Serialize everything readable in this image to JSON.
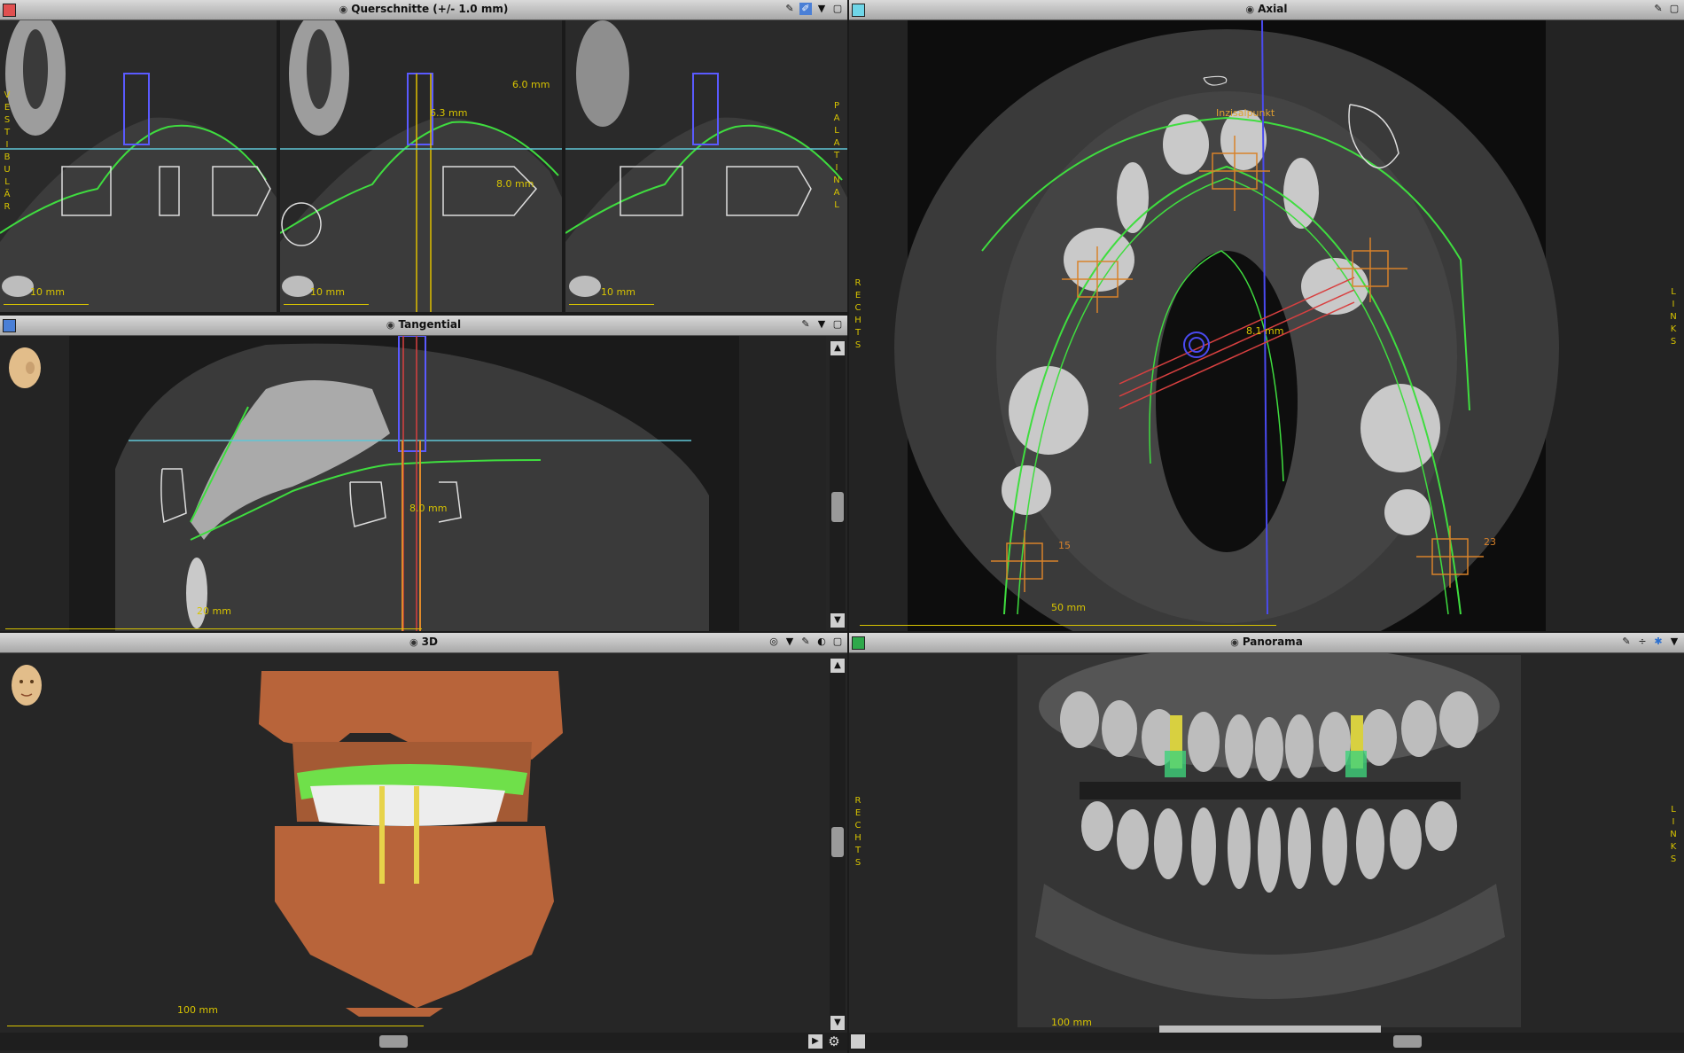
{
  "panels": {
    "cross": {
      "title": "Querschnitte (+/- 1.0 mm)",
      "color": "#e05050",
      "side_left": [
        "V",
        "E",
        "S",
        "T",
        "I",
        "B",
        "U",
        "L",
        "Ä",
        "R"
      ],
      "side_right": [
        "P",
        "A",
        "L",
        "A",
        "T",
        "I",
        "N",
        "A",
        "L"
      ],
      "scales": [
        "10 mm",
        "10 mm",
        "10 mm"
      ],
      "measures": [
        "6.3 mm",
        "8.0 mm",
        "6.0 mm"
      ]
    },
    "axial": {
      "title": "Axial",
      "color": "#6fd6e8",
      "side_left": [
        "R",
        "E",
        "C",
        "H",
        "T",
        "S"
      ],
      "side_right": [
        "L",
        "I",
        "N",
        "K",
        "S"
      ],
      "scale": "50 mm",
      "measure": "8.1 mm",
      "marker_left": "15",
      "marker_right": "23",
      "label_top": "Inzisalpunkt"
    },
    "tangential": {
      "title": "Tangential",
      "color": "#4a7fd6",
      "measure": "8.0 mm",
      "scale": "20 mm"
    },
    "three_d": {
      "title": "3D",
      "scale": "100 mm"
    },
    "panorama": {
      "title": "Panorama",
      "color": "#2ea84a",
      "side_left": [
        "R",
        "E",
        "C",
        "H",
        "T",
        "S"
      ],
      "side_right": [
        "L",
        "I",
        "N",
        "K",
        "S"
      ],
      "scale": "100 mm"
    }
  }
}
